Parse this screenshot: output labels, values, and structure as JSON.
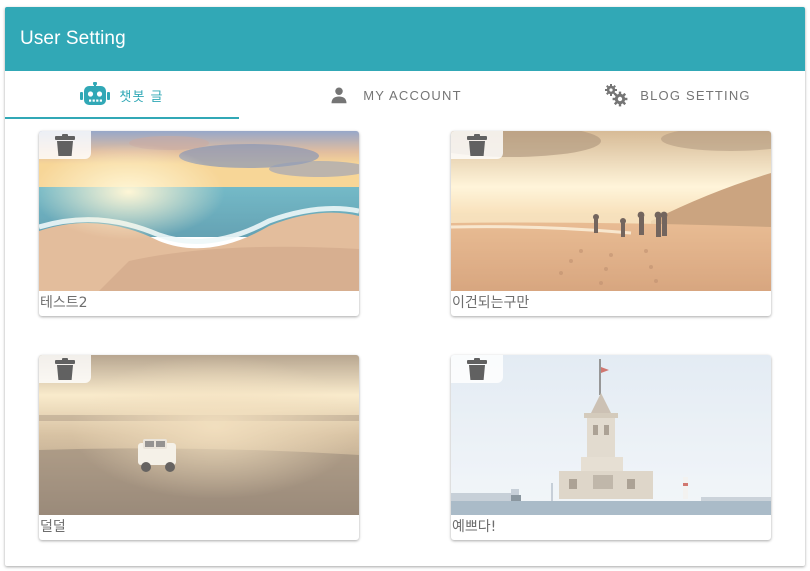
{
  "header": {
    "title": "User Setting",
    "color": "#31a8b6"
  },
  "tabs": [
    {
      "label": "챗봇 글",
      "icon": "robot-icon",
      "active": true
    },
    {
      "label": "MY ACCOUNT",
      "icon": "person-icon",
      "active": false
    },
    {
      "label": "BLOG SETTING",
      "icon": "gears-icon",
      "active": false
    }
  ],
  "cards": [
    {
      "caption": "테스트2",
      "image": "beach-sunset-waves-image",
      "action_icon": "trash-icon"
    },
    {
      "caption": "이건되는구만",
      "image": "people-walking-beach-image",
      "action_icon": "trash-icon"
    },
    {
      "caption": "덜덜",
      "image": "truck-desert-dust-image",
      "action_icon": "trash-icon"
    },
    {
      "caption": "예쁘다!",
      "image": "maidens-tower-image",
      "action_icon": "trash-icon"
    }
  ]
}
